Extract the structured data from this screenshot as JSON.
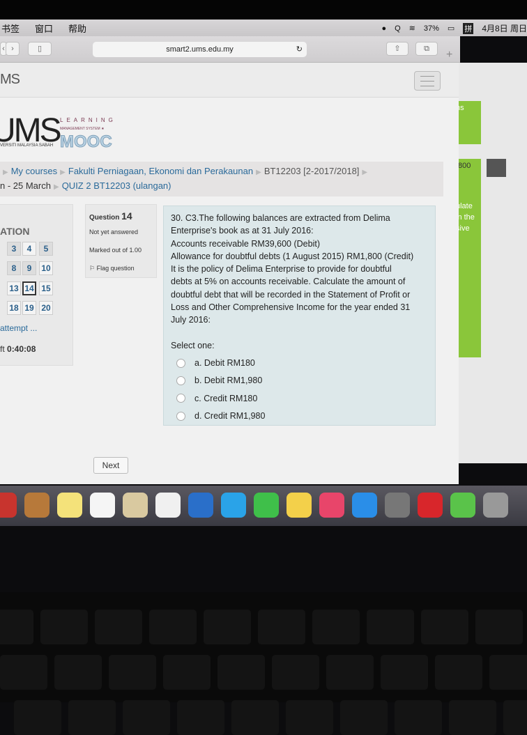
{
  "menubar": {
    "items": [
      "书签",
      "窗口",
      "帮助"
    ],
    "battery": "37%",
    "input_method": "拼",
    "datetime": "4月8日 周日"
  },
  "browser": {
    "url": "smart2.ums.edu.my",
    "new_tab": "+"
  },
  "site": {
    "brand": "MS",
    "logo_text": "UMS",
    "logo_sub": "VERSITI MALAYSIA SABAH",
    "logo_learning": "LEARNING",
    "logo_ms": "MANAGEMENT SYSTEM ★",
    "logo_mooc": "MOOC"
  },
  "breadcrumb": {
    "items": [
      "My courses",
      "Fakulti Perniagaan, Ekonomi dan Perakaunan",
      "BT12203 [2-2017/2018]"
    ],
    "line2_prefix": "n - 25 March",
    "current": "QUIZ 2 BT12203 (ulangan)"
  },
  "quiz_nav": {
    "title": "ATION",
    "buttons": [
      {
        "n": "3",
        "answered": true
      },
      {
        "n": "4",
        "answered": false
      },
      {
        "n": "5",
        "answered": true
      },
      {
        "n": "8",
        "answered": true
      },
      {
        "n": "9",
        "answered": true
      },
      {
        "n": "10",
        "answered": false
      },
      {
        "n": "13",
        "answered": false
      },
      {
        "n": "14",
        "answered": false,
        "current": true
      },
      {
        "n": "15",
        "answered": false
      },
      {
        "n": "18",
        "answered": false
      },
      {
        "n": "19",
        "answered": false
      },
      {
        "n": "20",
        "answered": false
      }
    ],
    "finish": "attempt ...",
    "time_left_label": "ft",
    "time_left": "0:40:08"
  },
  "question_info": {
    "label": "Question",
    "number": "14",
    "status": "Not yet answered",
    "marks": "Marked out of 1.00",
    "flag": "Flag question"
  },
  "question": {
    "lines": [
      "30. C3.The following balances are extracted from Delima",
      "Enterprise's book as at 31 July 2016:",
      "Accounts receivable RM39,600 (Debit)",
      "Allowance for doubtful debts (1 August 2015) RM1,800 (Credit)",
      "It is the policy of Delima Enterprise to provide for doubtful",
      "debts at 5% on accounts receivable. Calculate the amount of",
      "doubtful debt that will be recorded in the Statement of Profit or",
      "Loss and Other Comprehensive Income for the year ended 31",
      "July 2016:"
    ],
    "prompt": "Select one:",
    "options": [
      "a. Debit RM180",
      "b. Debit RM1,980",
      "c. Credit RM180",
      "d. Credit RM1,980"
    ]
  },
  "next_label": "Next",
  "background_window": {
    "snippets": [
      "ns",
      ",800",
      "ulate",
      "in the",
      "sive"
    ]
  }
}
